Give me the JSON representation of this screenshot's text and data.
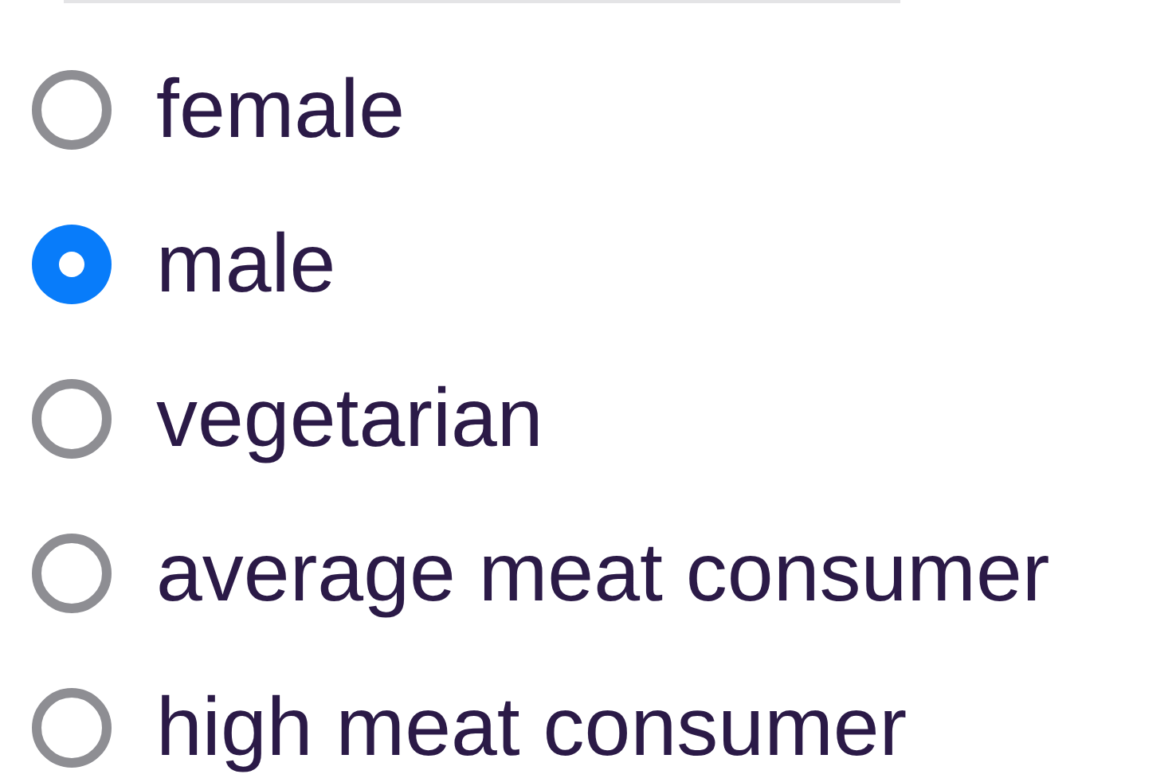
{
  "options": [
    {
      "label": "female",
      "selected": false
    },
    {
      "label": "male",
      "selected": true
    },
    {
      "label": "vegetarian",
      "selected": false
    },
    {
      "label": "average meat consumer",
      "selected": false
    },
    {
      "label": "high meat consumer",
      "selected": false
    }
  ]
}
